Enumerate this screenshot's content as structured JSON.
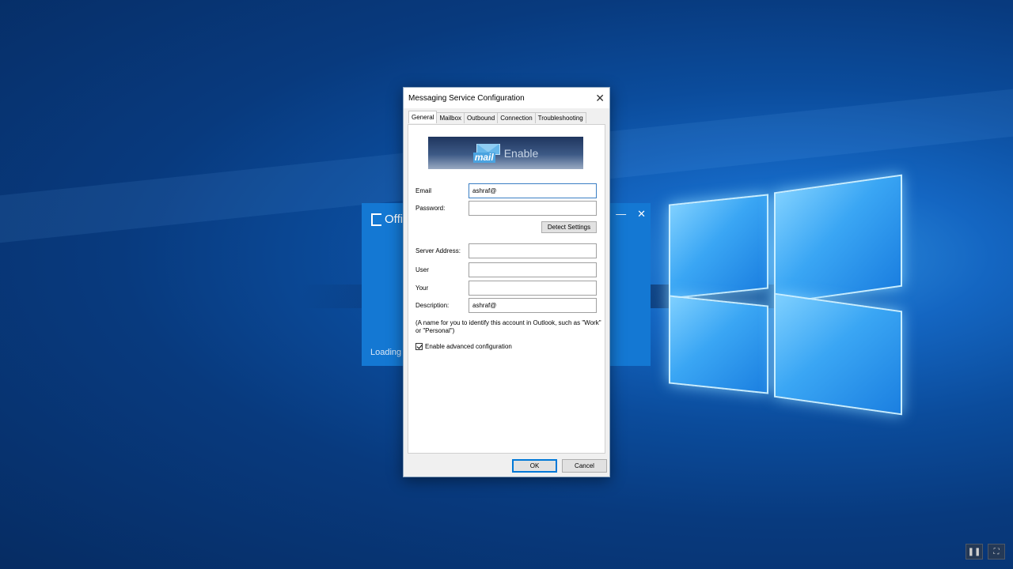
{
  "dialog": {
    "title": "Messaging Service Configuration",
    "close_glyph": "✕",
    "tabs": [
      {
        "label": "General",
        "active": true
      },
      {
        "label": "Mailbox"
      },
      {
        "label": "Outbound"
      },
      {
        "label": "Connection"
      },
      {
        "label": "Troubleshooting"
      }
    ],
    "banner": {
      "mail": "mail",
      "enable": "Enable"
    },
    "fields": {
      "email": {
        "label": "Email",
        "value": "ashraf@"
      },
      "password": {
        "label": "Password:",
        "value": ""
      },
      "server": {
        "label": "Server Address:",
        "value": ""
      },
      "user": {
        "label": "User",
        "value": ""
      },
      "your": {
        "label": "Your",
        "value": ""
      },
      "description": {
        "label": "Description:",
        "value": "ashraf@"
      }
    },
    "detect_button": "Detect Settings",
    "note": "(A name for you to identify this account in Outlook, such as \"Work\" or \"Personal\")",
    "advanced_checkbox": {
      "label": "Enable advanced configuration",
      "checked": true
    },
    "ok_button": "OK",
    "cancel_button": "Cancel"
  },
  "office_splash": {
    "title": "Offi",
    "loading": "Loading I",
    "minimize_glyph": "—",
    "close_glyph": "✕"
  },
  "colors": {
    "accent": "#0078d7",
    "splash": "#1478d3"
  }
}
